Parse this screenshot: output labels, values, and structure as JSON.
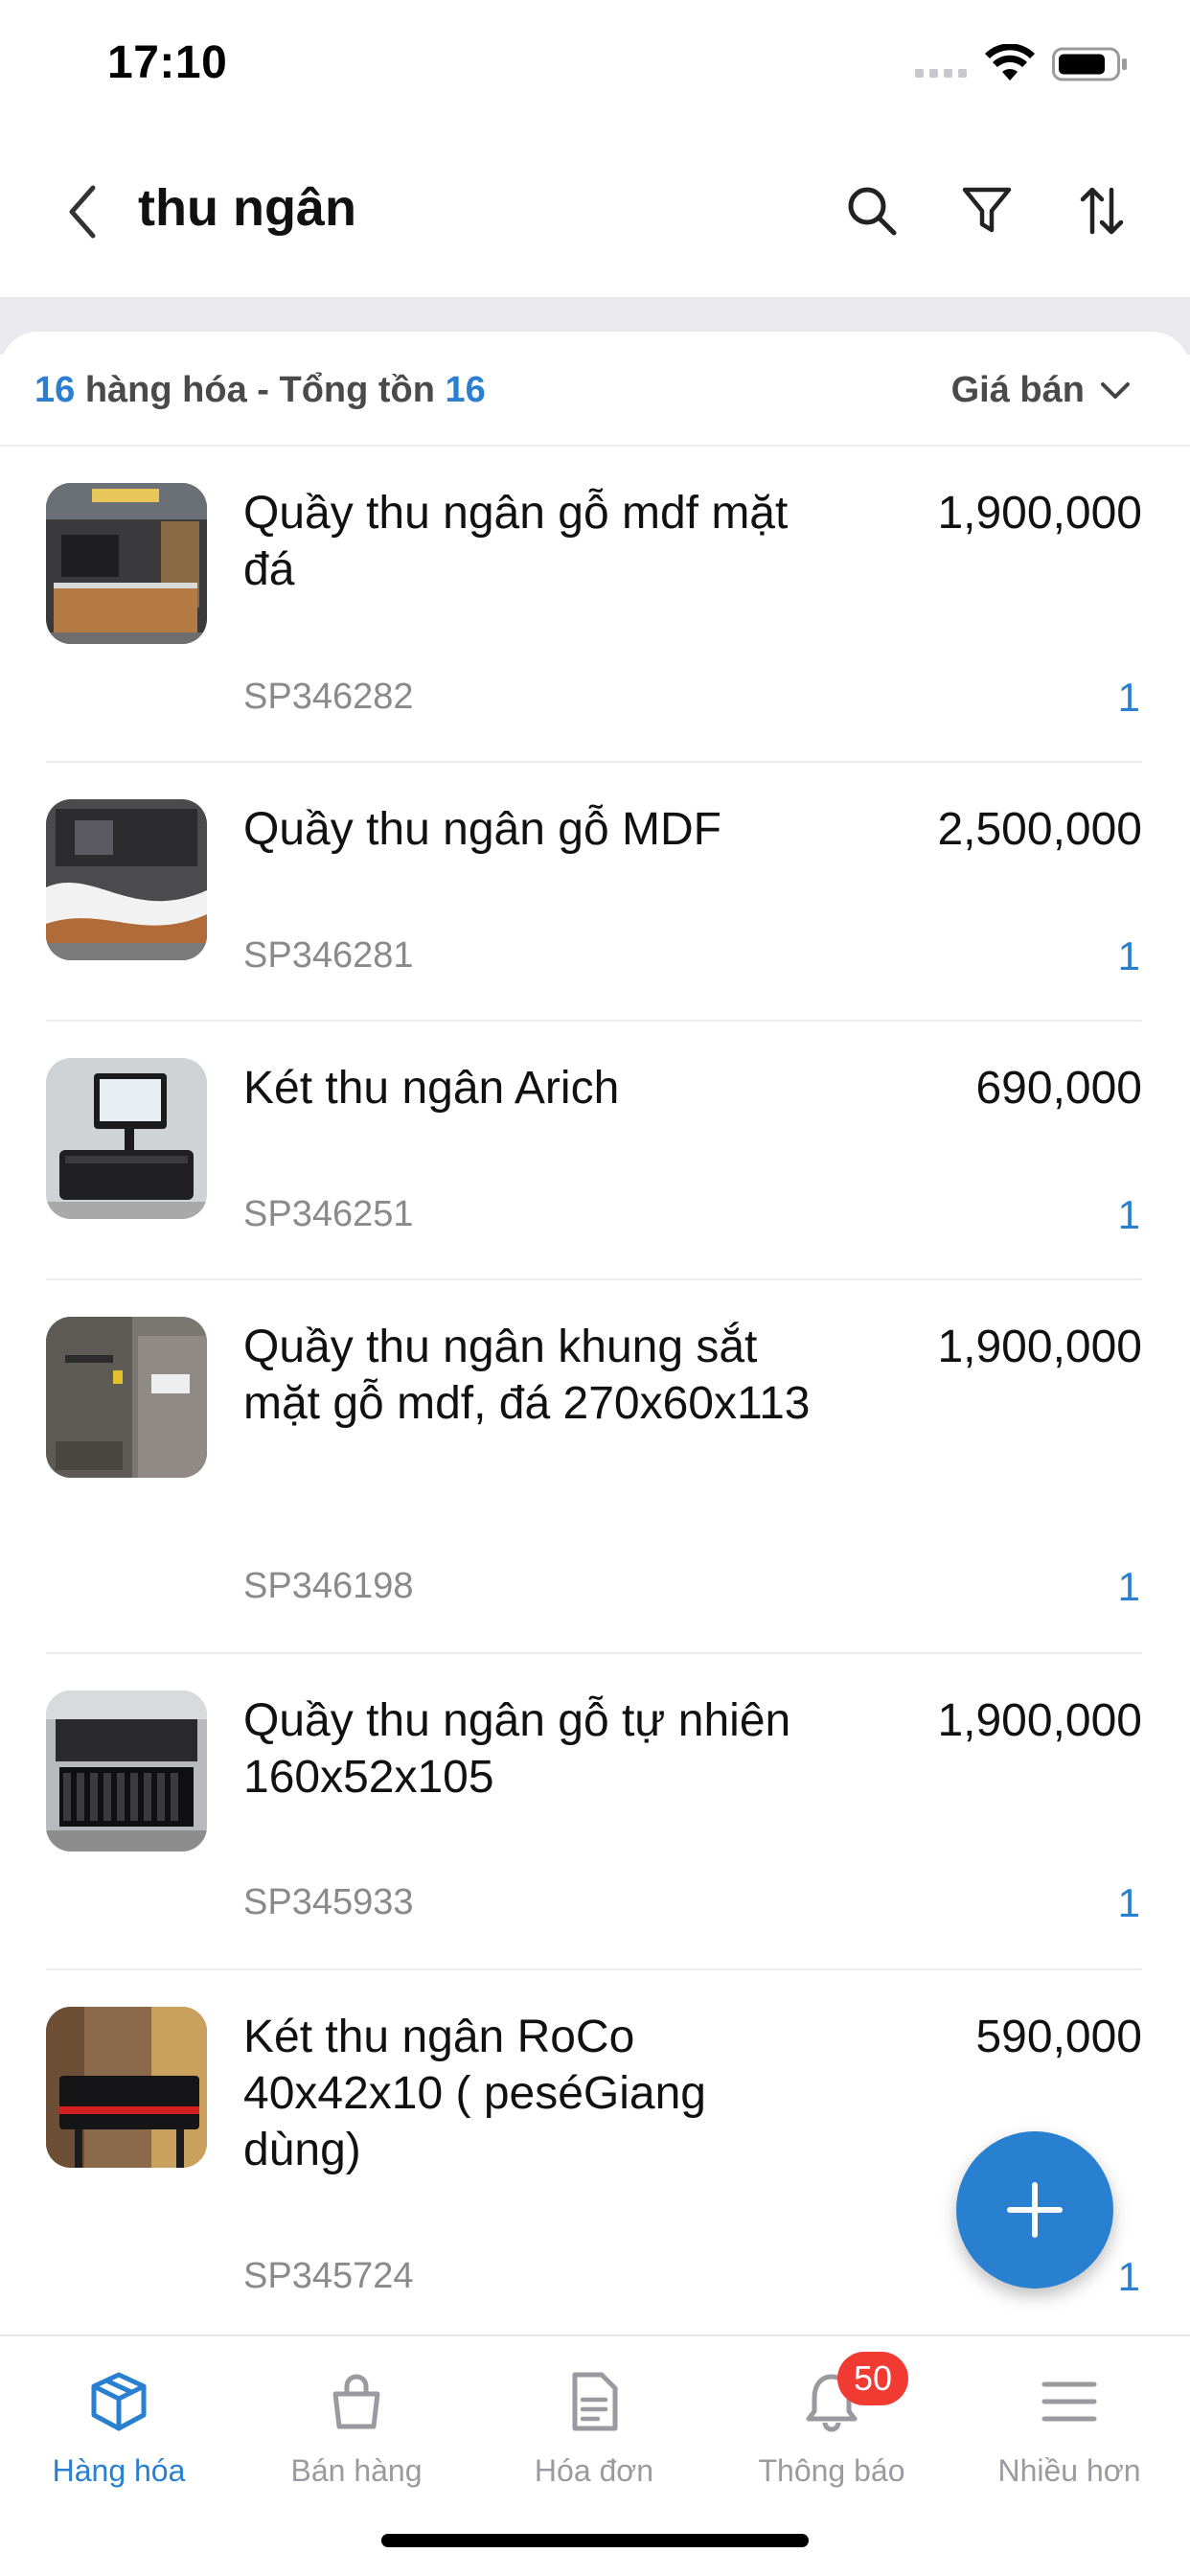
{
  "status_bar": {
    "time": "17:10"
  },
  "header": {
    "title": "thu ngân"
  },
  "summary": {
    "count": "16",
    "label_mid": " hàng hóa - Tổng tồn ",
    "total": "16",
    "sort_label": "Giá bán"
  },
  "items": [
    {
      "name": "Quầy thu ngân gỗ mdf mặt đá",
      "price": "1,900,000",
      "code": "SP346282",
      "qty": "1"
    },
    {
      "name": "Quầy thu ngân gỗ MDF",
      "price": "2,500,000",
      "code": "SP346281",
      "qty": "1"
    },
    {
      "name": "Két thu ngân Arich",
      "price": "690,000",
      "code": "SP346251",
      "qty": "1"
    },
    {
      "name": "Quầy thu ngân khung sắt mặt gỗ mdf, đá 270x60x113",
      "price": "1,900,000",
      "code": "SP346198",
      "qty": "1"
    },
    {
      "name": "Quầy thu ngân gỗ tự nhiên 160x52x105",
      "price": "1,900,000",
      "code": "SP345933",
      "qty": "1"
    },
    {
      "name": "Két thu ngân RoCo 40x42x10 ( peséGiang dùng)",
      "price": "590,000",
      "code": "SP345724",
      "qty": "1"
    }
  ],
  "tabs": [
    {
      "label": "Hàng hóa",
      "icon": "box-icon",
      "active": true
    },
    {
      "label": "Bán hàng",
      "icon": "shopping-bag-icon",
      "active": false
    },
    {
      "label": "Hóa đơn",
      "icon": "document-icon",
      "active": false
    },
    {
      "label": "Thông báo",
      "icon": "bell-icon",
      "active": false,
      "badge": "50"
    },
    {
      "label": "Nhiều hơn",
      "icon": "menu-icon",
      "active": false
    }
  ],
  "colors": {
    "accent": "#2a80d0",
    "badge": "#f03a32"
  }
}
